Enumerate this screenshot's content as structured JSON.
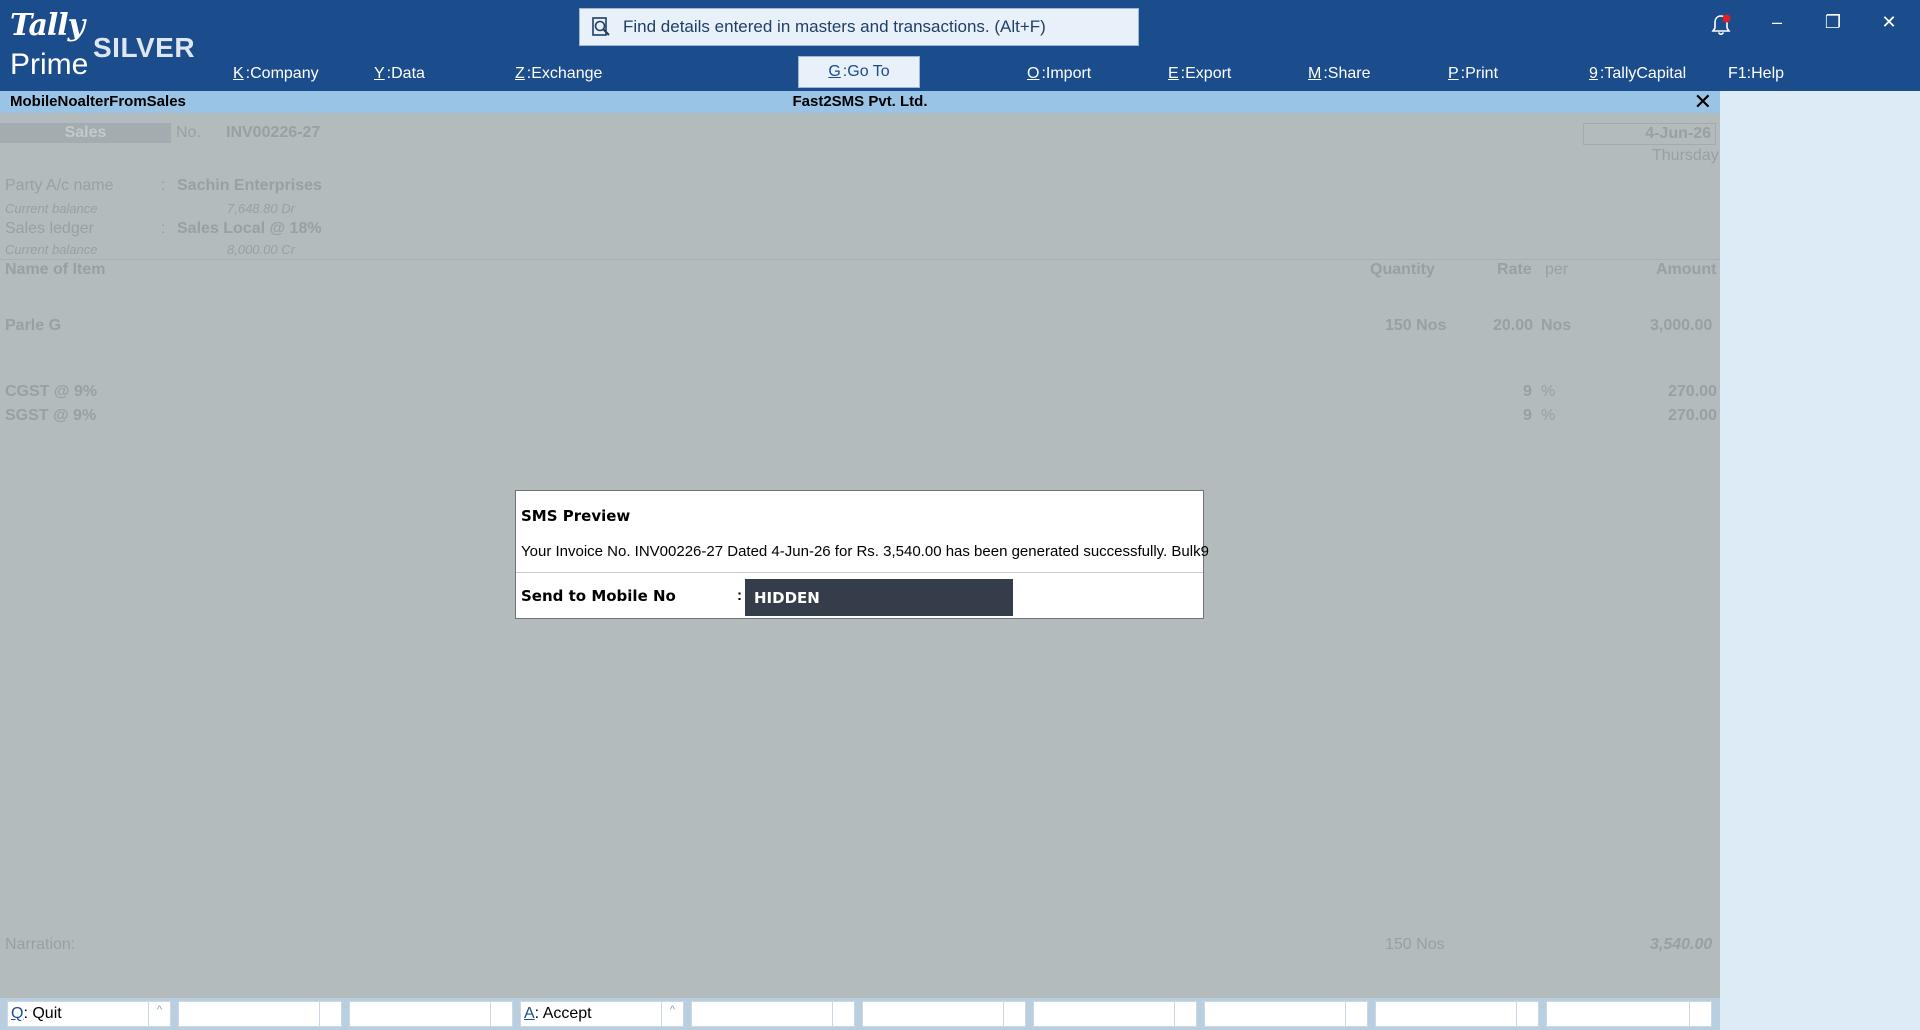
{
  "app": {
    "logo_tally": "Tally",
    "logo_prime": "Prime",
    "edition": "SILVER"
  },
  "search": {
    "placeholder": "Find details entered in masters and transactions. (Alt+F)",
    "icon": "search-document-icon"
  },
  "menu": [
    {
      "key": "K",
      "label": "Company"
    },
    {
      "key": "Y",
      "label": "Data"
    },
    {
      "key": "Z",
      "label": "Exchange"
    },
    {
      "key": "G",
      "label": "Go To"
    },
    {
      "key": "O",
      "label": "Import"
    },
    {
      "key": "E",
      "label": "Export"
    },
    {
      "key": "M",
      "label": "Share"
    },
    {
      "key": "P",
      "label": "Print"
    },
    {
      "key": "9",
      "label": "TallyCapital"
    },
    {
      "key": "F1",
      "label": "Help"
    }
  ],
  "window_controls": {
    "notification_icon": "bell-icon",
    "minimize": "–",
    "restore": "❐",
    "close": "✕"
  },
  "titlebar": {
    "screen": "MobileNoalterFromSales",
    "company": "Fast2SMS Pvt. Ltd.",
    "close": "✕"
  },
  "voucher": {
    "type": "Sales",
    "no_label": "No.",
    "number": "INV00226-27",
    "date": "4-Jun-26",
    "day": "Thursday",
    "party_label": "Party A/c name",
    "party_name": "Sachin Enterprises",
    "party_balance_label": "Current balance",
    "party_balance": "7,648.80 Dr",
    "sales_ledger_label": "Sales ledger",
    "sales_ledger": "Sales Local @ 18%",
    "sales_balance_label": "Current balance",
    "sales_balance": "8,000.00 Cr",
    "columns": {
      "item": "Name of Item",
      "quantity": "Quantity",
      "rate": "Rate",
      "per": "per",
      "amount": "Amount"
    },
    "items": [
      {
        "name": "Parle G",
        "quantity": "150 Nos",
        "rate": "20.00",
        "per": "Nos",
        "amount": "3,000.00"
      }
    ],
    "taxes": [
      {
        "name": "CGST @ 9%",
        "rate": "9",
        "per": "%",
        "amount": "270.00"
      },
      {
        "name": "SGST @ 9%",
        "rate": "9",
        "per": "%",
        "amount": "270.00"
      }
    ],
    "narration_label": "Narration:",
    "total_quantity": "150 Nos",
    "total_amount": "3,540.00"
  },
  "dialog": {
    "title": "SMS Preview",
    "message": "Your Invoice No. INV00226-27 Dated 4-Jun-26 for Rs. 3,540.00 has been generated successfully. Bulk9",
    "field_label": "Send to Mobile No",
    "colon": ":",
    "field_value": "HIDDEN"
  },
  "bottom_buttons": [
    {
      "key": "Q",
      "label": "Quit",
      "sub": "^"
    },
    {
      "key": "",
      "label": "",
      "sub": ""
    },
    {
      "key": "",
      "label": "",
      "sub": ""
    },
    {
      "key": "A",
      "label": "Accept",
      "sub": "^"
    },
    {
      "key": "",
      "label": "",
      "sub": ""
    },
    {
      "key": "",
      "label": "",
      "sub": ""
    },
    {
      "key": "",
      "label": "",
      "sub": ""
    },
    {
      "key": "",
      "label": "",
      "sub": ""
    },
    {
      "key": "",
      "label": "",
      "sub": ""
    },
    {
      "key": "",
      "label": "",
      "sub": ""
    }
  ]
}
